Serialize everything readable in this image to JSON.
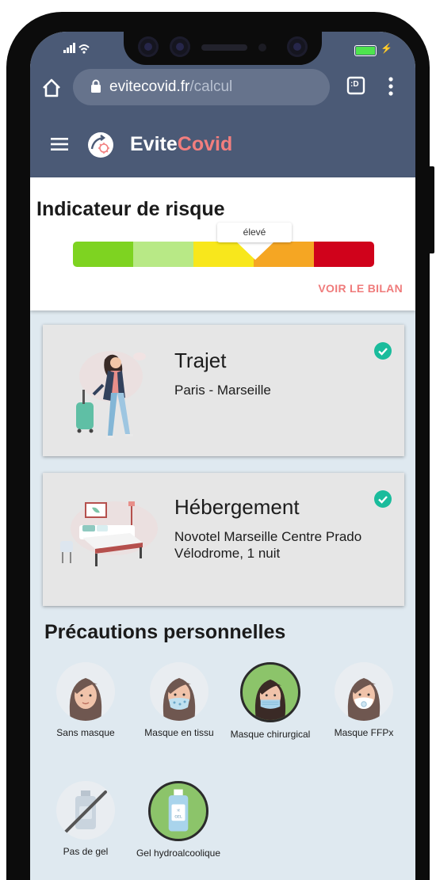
{
  "browser": {
    "url_domain": "evitecovid.fr",
    "url_path": "/calcul",
    "tabs_label": ":D"
  },
  "app": {
    "brand_part1": "Evite",
    "brand_part2": "Covid"
  },
  "risk": {
    "title": "Indicateur de risque",
    "level_label": "élevé",
    "level_index": 3,
    "segments": [
      "#7ed321",
      "#b8e986",
      "#f8e71c",
      "#f5a623",
      "#d0021b"
    ],
    "bilan_link": "VOIR LE BILAN"
  },
  "cards": [
    {
      "title": "Trajet",
      "subtitle": "Paris - Marseille",
      "checked": true
    },
    {
      "title": "Hébergement",
      "subtitle": "Novotel Marseille Centre Prado Vélodrome, 1 nuit",
      "checked": true
    }
  ],
  "precautions": {
    "title": "Précautions personnelles",
    "masks": [
      {
        "label": "Sans masque",
        "selected": false
      },
      {
        "label": "Masque en tissu",
        "selected": false
      },
      {
        "label": "Masque chirurgical",
        "selected": true
      },
      {
        "label": "Masque FFPx",
        "selected": false
      }
    ],
    "gel": [
      {
        "label": "Pas de gel",
        "selected": false
      },
      {
        "label": "Gel hydroalcoolique",
        "selected": true
      }
    ]
  },
  "colors": {
    "header": "#4b5a76",
    "accent": "#f27e7e",
    "check": "#1abc9c",
    "selected_bg": "#8cc46a"
  }
}
